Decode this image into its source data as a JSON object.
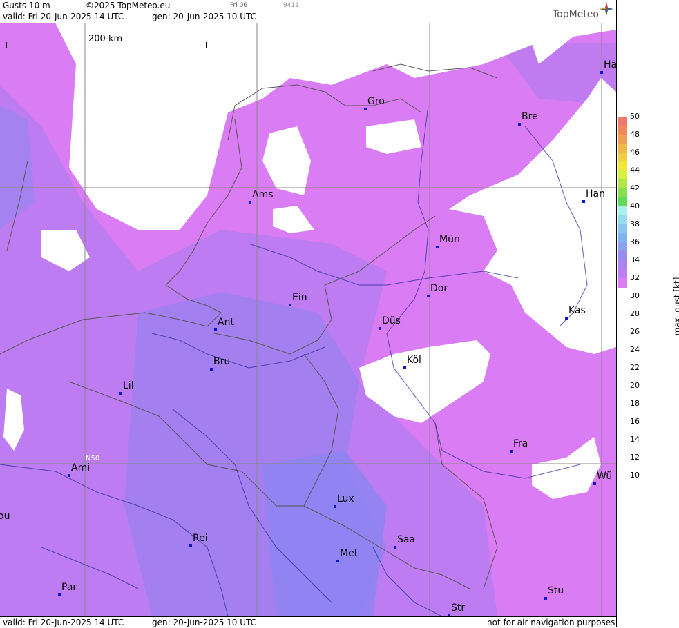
{
  "header": {
    "product": "Gusts 10 m",
    "copyright": "©2025 TopMeteo.eu",
    "run_code": "Fri 06",
    "code2": "9411",
    "valid": "valid:  Fri  20-Jun-2025  14 UTC",
    "gen": "gen: 20-Jun-2025 10 UTC",
    "brand": "TopMeteo"
  },
  "footer": {
    "valid": "valid:  Fri  20-Jun-2025  14 UTC",
    "gen": "gen: 20-Jun-2025 10 UTC",
    "note": "not for air navigation purposes"
  },
  "scale_label": "200 km",
  "lat_label": "N50",
  "cities": [
    {
      "name": "Ha"
    },
    {
      "name": "Gro"
    },
    {
      "name": "Bre"
    },
    {
      "name": "Ams"
    },
    {
      "name": "Han"
    },
    {
      "name": "Mün"
    },
    {
      "name": "Dor"
    },
    {
      "name": "Ein"
    },
    {
      "name": "Kas"
    },
    {
      "name": "Düs"
    },
    {
      "name": "Ant"
    },
    {
      "name": "Köl"
    },
    {
      "name": "Bru"
    },
    {
      "name": "Lil"
    },
    {
      "name": "Fra"
    },
    {
      "name": "Ami"
    },
    {
      "name": "Wü"
    },
    {
      "name": "Lux"
    },
    {
      "name": "Rei"
    },
    {
      "name": "Saa"
    },
    {
      "name": "Met"
    },
    {
      "name": "Par"
    },
    {
      "name": "Stu"
    },
    {
      "name": "Str"
    },
    {
      "name": "ou"
    }
  ],
  "legend": {
    "title": "max. gust [kt]",
    "ticks": [
      "50",
      "48",
      "46",
      "44",
      "42",
      "40",
      "38",
      "36",
      "34",
      "32",
      "30",
      "28",
      "26",
      "24",
      "22",
      "20",
      "18",
      "16",
      "14",
      "12",
      "10"
    ],
    "colors": [
      "#f07a6a",
      "#f08a5a",
      "#f0a050",
      "#f0b848",
      "#f0d040",
      "#f0e838",
      "#d8f040",
      "#b0e848",
      "#88e050",
      "#60d858",
      "#a8f0f0",
      "#98dcf0",
      "#88c8f0",
      "#80b4f0",
      "#8ca0f0",
      "#9a8cf0",
      "#aa86f0",
      "#c07ef0",
      "#da7cf3",
      "#ffffff"
    ]
  }
}
